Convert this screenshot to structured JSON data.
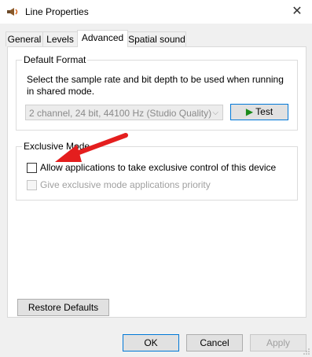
{
  "window": {
    "title": "Line Properties"
  },
  "tabs": [
    {
      "label": "General"
    },
    {
      "label": "Levels"
    },
    {
      "label": "Advanced"
    },
    {
      "label": "Spatial sound"
    }
  ],
  "default_format": {
    "group_label": "Default Format",
    "description": "Select the sample rate and bit depth to be used when running in shared mode.",
    "selected_format": "2 channel, 24 bit, 44100 Hz (Studio Quality)",
    "test_label": "Test"
  },
  "exclusive_mode": {
    "group_label": "Exclusive Mode",
    "allow_label": "Allow applications to take exclusive control of this device",
    "priority_label": "Give exclusive mode applications priority",
    "allow_checked": false,
    "priority_checked": false
  },
  "buttons": {
    "restore": "Restore Defaults",
    "ok": "OK",
    "cancel": "Cancel",
    "apply": "Apply"
  },
  "colors": {
    "annotation_arrow": "#e41e1e",
    "test_play": "#1a8a1a",
    "focus": "#0078d7"
  }
}
